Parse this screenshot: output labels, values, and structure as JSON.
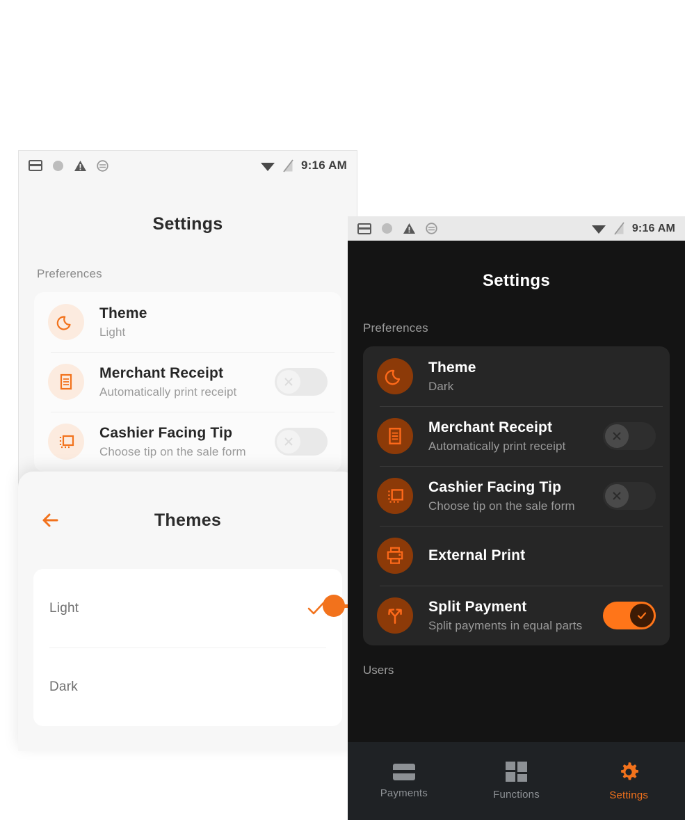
{
  "theme_colors": {
    "accent": "#f2721c",
    "accent_bright": "#ff7519",
    "dark_icon_bg": "#8c3a08",
    "light_icon_bg": "#fcebdf",
    "dark_card": "#262626",
    "dark_bg": "#141414",
    "light_bg": "#f6f6f6",
    "nav_bg": "#1f2225"
  },
  "status_bar": {
    "time": "9:16 AM",
    "left_icons": [
      "card-icon",
      "circle-icon",
      "warning-triangle-icon",
      "sync-icon"
    ],
    "right_icons": [
      "wifi-icon",
      "signal-off-icon"
    ]
  },
  "light_screen": {
    "title": "Settings",
    "section_label": "Preferences",
    "rows": [
      {
        "icon": "moon-icon",
        "title": "Theme",
        "subtitle": "Light",
        "toggle": "none"
      },
      {
        "icon": "receipt-icon",
        "title": "Merchant Receipt",
        "subtitle": "Automatically print receipt",
        "toggle": "off"
      },
      {
        "icon": "tip-screen-icon",
        "title": "Cashier Facing Tip",
        "subtitle": "Choose tip on the sale form",
        "toggle": "off"
      }
    ]
  },
  "themes_overlay": {
    "title": "Themes",
    "back_icon": "arrow-left-icon",
    "options": [
      {
        "label": "Light",
        "selected": true
      },
      {
        "label": "Dark",
        "selected": false
      }
    ]
  },
  "dark_screen": {
    "title": "Settings",
    "section_label": "Preferences",
    "users_label": "Users",
    "rows": [
      {
        "icon": "moon-icon",
        "title": "Theme",
        "subtitle": "Dark",
        "toggle": "none"
      },
      {
        "icon": "receipt-icon",
        "title": "Merchant Receipt",
        "subtitle": "Automatically print receipt",
        "toggle": "off"
      },
      {
        "icon": "tip-screen-icon",
        "title": "Cashier Facing Tip",
        "subtitle": "Choose tip on the sale form",
        "toggle": "off"
      },
      {
        "icon": "printer-icon",
        "title": "External Print",
        "subtitle": "",
        "toggle": "none"
      },
      {
        "icon": "split-arrows-icon",
        "title": "Split Payment",
        "subtitle": "Split payments in equal parts",
        "toggle": "on"
      }
    ],
    "bottom_nav": [
      {
        "label": "Payments",
        "icon": "card-icon",
        "active": false
      },
      {
        "label": "Functions",
        "icon": "grid-icon",
        "active": false
      },
      {
        "label": "Settings",
        "icon": "gear-icon",
        "active": true
      }
    ]
  }
}
